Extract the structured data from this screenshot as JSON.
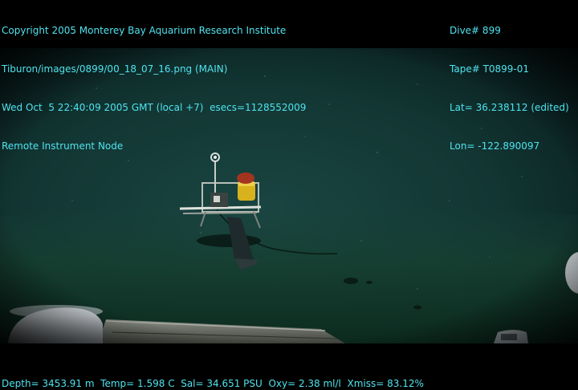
{
  "overlay": {
    "top_left": [
      "Copyright 2005 Monterey Bay Aquarium Research Institute",
      "Tiburon/images/0899/00_18_07_16.png (MAIN)",
      "Wed Oct  5 22:40:09 2005 GMT (local +7)  esecs=1128552009",
      "Remote Instrument Node"
    ],
    "top_right": [
      "Dive# 899",
      "Tape# T0899-01",
      "Lat= 36.238112 (edited)",
      "Lon= -122.890097"
    ],
    "bottom": "Depth= 3453.91 m  Temp= 1.598 C  Sal= 34.651 PSU  Oxy= 2.38 ml/l  Xmiss= 83.12%"
  },
  "colors": {
    "overlay_text": "#4fe3ee",
    "water": "#0f2f30",
    "seafloor": "#123a2a",
    "letterbox": "#000000",
    "instrument_float": "#d8b21c"
  }
}
